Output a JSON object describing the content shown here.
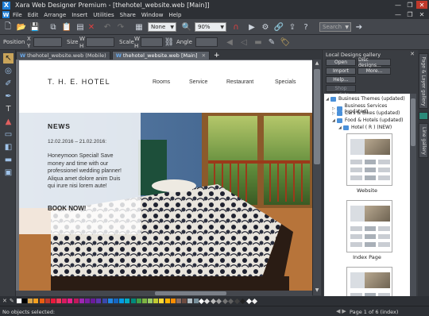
{
  "window": {
    "title": "Xara Web Designer Premium - [thehotel_website.web [Main]]",
    "logo_letter": "X"
  },
  "menu": {
    "items": [
      "File",
      "Edit",
      "Arrange",
      "Insert",
      "Utilities",
      "Share",
      "Window",
      "Help"
    ]
  },
  "toolbar1": {
    "quality_select": "None",
    "zoom_select": "90%",
    "search_placeholder": "Search"
  },
  "toolbar2": {
    "position_label": "Position",
    "x_label": "X",
    "y_label": "Y",
    "size_label": "Size",
    "w_label": "W",
    "h_label": "H",
    "scale_label": "Scale",
    "angle_label": "Angle"
  },
  "tabs": [
    {
      "label": "thehotel_website.web (Mobile)",
      "active": false
    },
    {
      "label": "thehotel_website.web [Main]",
      "active": true
    }
  ],
  "page": {
    "brand": "T. H. E.  HOTEL",
    "nav": [
      "Rooms",
      "Service",
      "Restaurant",
      "Specials"
    ],
    "overlay": {
      "heading": "NEWS",
      "dates": "12.02.2016 – 21.02.2016:",
      "body": "Honeymoon Special! Save money and time with our professionel wedding planner! Aliqua amet dolore anim Duis qui irure nisi lorem aute!",
      "cta": "BOOK NOW!"
    }
  },
  "gallery": {
    "title": "Local Designs gallery",
    "buttons": {
      "open": "Open",
      "disc": "Disc designs...",
      "import": "Import",
      "more": "More...",
      "help": "Help..."
    },
    "shop_label": "Shop update",
    "tree": [
      {
        "label": "Business Themes (updated)",
        "level": 0
      },
      {
        "label": "Business Services (updated)",
        "level": 1
      },
      {
        "label": "Cars & Bikes (updated)",
        "level": 1
      },
      {
        "label": "Food & Hotels (updated)",
        "level": 1
      },
      {
        "label": "Hotel ( R ) (NEW)",
        "level": 2
      }
    ],
    "thumbs": [
      "Website",
      "Index Page"
    ]
  },
  "right_tabs": [
    "Page & Layer gallery",
    "Line gallery"
  ],
  "palette_colors": [
    "#ffffff",
    "#000000",
    "#d9a44a",
    "#f4a020",
    "#e85d10",
    "#c0392b",
    "#e8193c",
    "#f03a5a",
    "#d81b60",
    "#e91e8c",
    "#c2185b",
    "#9c27b0",
    "#7b1fa2",
    "#6a1b9a",
    "#5e35b1",
    "#3949ab",
    "#1e88e5",
    "#1565c0",
    "#039be5",
    "#00acc1",
    "#00897b",
    "#43a047",
    "#7cb342",
    "#9ccc65",
    "#c0ca33",
    "#fdd835",
    "#ffb300",
    "#fb8c00",
    "#8d6e63",
    "#6d4c41",
    "#b0bec5",
    "#78909c",
    "#ffffff",
    "#e0e0e0",
    "#bdbdbd",
    "#9e9e9e",
    "#757575",
    "#616161",
    "#424242",
    "#212121",
    "#ffffff",
    "#eeeeee"
  ],
  "status": {
    "left": "No objects selected:",
    "right": "Page 1 of 6 (index)"
  }
}
